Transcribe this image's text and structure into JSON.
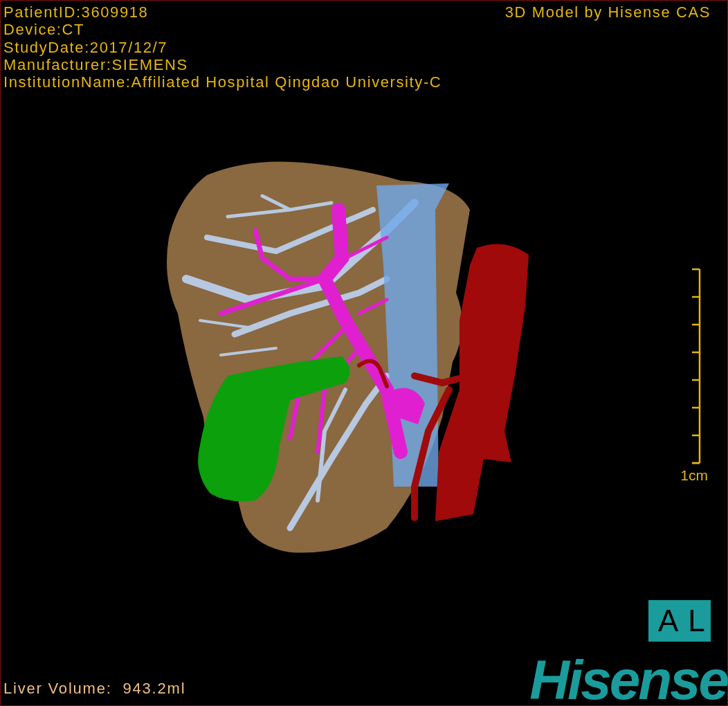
{
  "patient_info": [
    "PatientID:3609918",
    "Device:CT",
    "StudyDate:2017/12/7",
    "Manufacturer:SIEMENS",
    "InstitutionName:Affiliated Hospital Qingdao University-C"
  ],
  "title": "3D Model by Hisense CAS",
  "scale_bar": {
    "label": "1cm"
  },
  "orientation_label": "AL",
  "liver_volume": {
    "label": "Liver Volume:",
    "value": "943.2ml"
  },
  "logo": "Hisense"
}
